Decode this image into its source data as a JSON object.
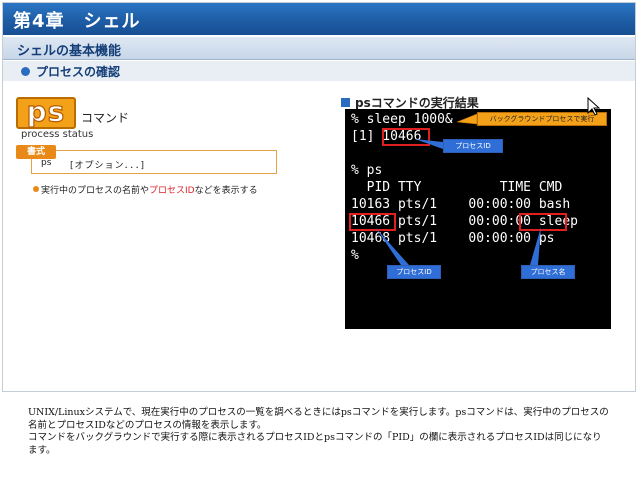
{
  "header": {
    "chapter_title": "第4章　シェル",
    "section_title": "シェルの基本機能",
    "subsection_title": "プロセスの確認"
  },
  "left": {
    "logo_text": "ps",
    "command_label": "コマンド",
    "full_name": "process status",
    "syntax_tag": "書式",
    "syntax_cmd": "ps",
    "syntax_args": "[オプション．．．]",
    "description_before": "実行中のプロセスの名前や",
    "description_accent": "プロセスID",
    "description_after": "などを表示する"
  },
  "right": {
    "title": "psコマンドの実行結果",
    "terminal_lines": [
      "% sleep 1000&",
      "[1] 10466",
      "",
      "% ps",
      "  PID TTY          TIME CMD",
      "10163 pts/1    00:00:00 bash",
      "10466 pts/1    00:00:00 sleep",
      "10468 pts/1    00:00:00 ps",
      "%"
    ],
    "callouts": {
      "background": "バックグラウンドプロセスで実行",
      "pid_top": "プロセスID",
      "pid_bottom": "プロセスID",
      "process_name": "プロセス名"
    }
  },
  "caption": {
    "lines": [
      "UNIX/Linuxシステムで、現在実行中のプロセスの一覧を調べるときにはpsコマンドを実行します。psコマンドは、実行中のプロセスの",
      "名前とプロセスIDなどのプロセスの情報を表示します。",
      "コマンドをバックグラウンドで実行する際に表示されるプロセスIDとpsコマンドの「PID」の欄に表示されるプロセスIDは同じになり",
      "ます。"
    ]
  },
  "colors": {
    "header_blue": "#1f5fa8",
    "accent_orange": "#f4a11a",
    "highlight_red": "#e02020",
    "terminal_bg": "#000000"
  }
}
